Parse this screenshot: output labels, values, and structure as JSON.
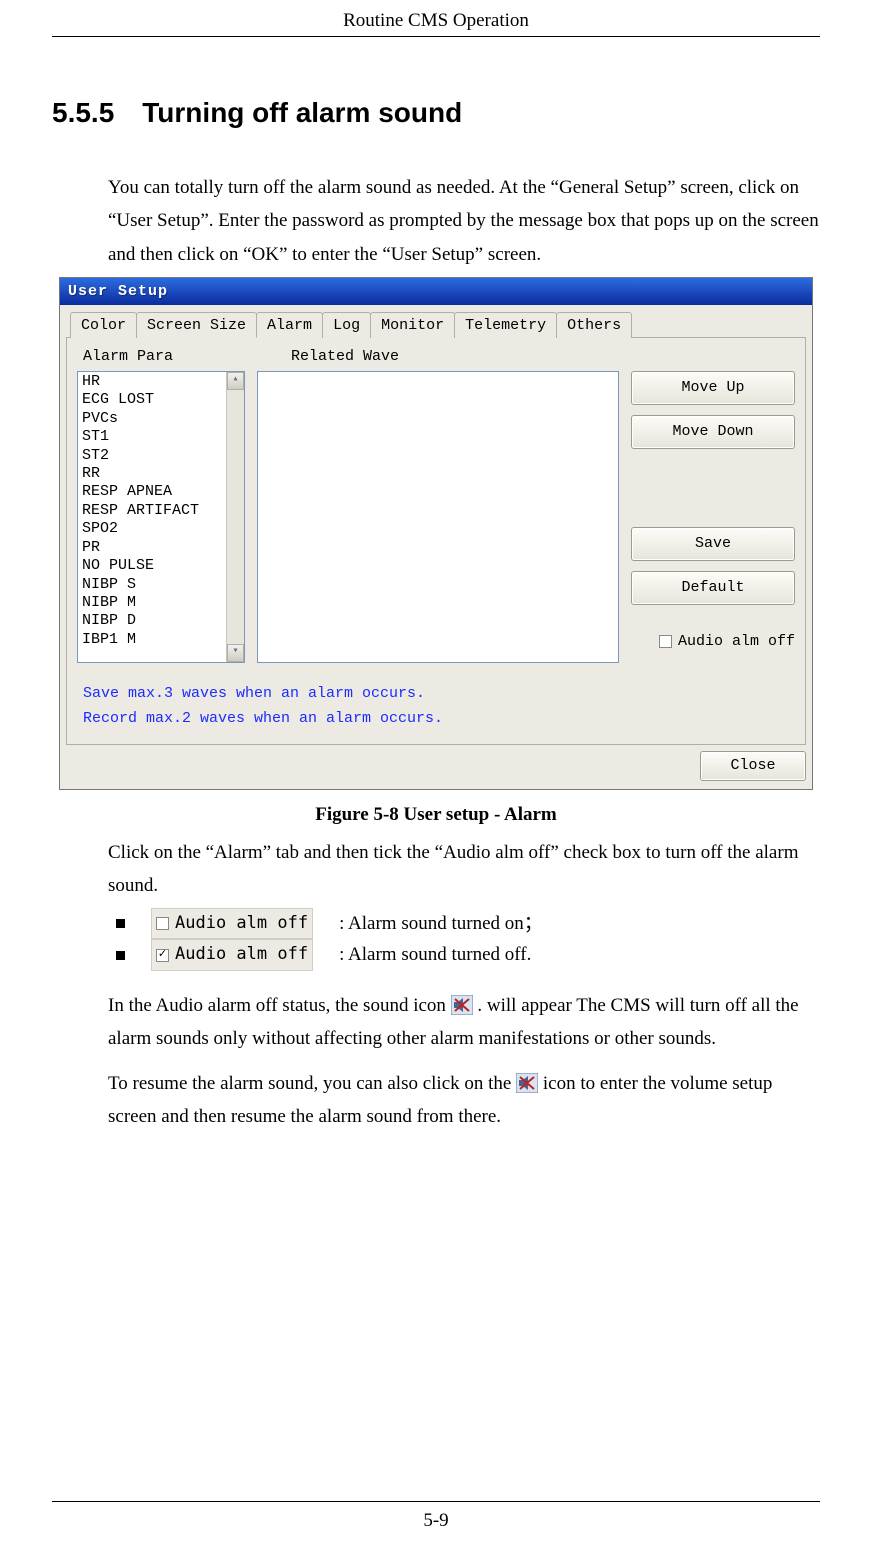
{
  "header": {
    "title": "Routine CMS Operation"
  },
  "section": {
    "number": "5.5.5",
    "title": "Turning off alarm sound"
  },
  "paragraphs": {
    "intro": "You can totally turn off the alarm sound as needed. At the “General Setup” screen, click on “User Setup”. Enter the password as prompted by the message box that pops up on the screen and then click on “OK” to enter the “User Setup” screen.",
    "after_figure": "Click on the “Alarm” tab and then tick the “Audio alm off” check box to turn off the alarm sound.",
    "bullet_on_label": "Audio alm off",
    "bullet_on_desc": ": Alarm sound turned on；",
    "bullet_off_label": "Audio alm off",
    "bullet_off_desc": ": Alarm sound turned off.",
    "status_p_a": "In the Audio alarm off status, the sound icon ",
    "status_p_b": ". will appear The CMS will turn off all the alarm sounds only without affecting other alarm manifestations or other sounds.",
    "resume_a": "To resume the alarm sound, you can also click on the ",
    "resume_b": " icon to enter the volume setup screen and then resume the alarm sound from there."
  },
  "figure": {
    "caption": "Figure 5-8 User setup - Alarm"
  },
  "dialog": {
    "title": "User Setup",
    "tabs": [
      "Color",
      "Screen Size",
      "Alarm",
      "Log",
      "Monitor",
      "Telemetry",
      "Others"
    ],
    "active_tab": "Alarm",
    "labels": {
      "alarm_para": "Alarm Para",
      "related_wave": "Related Wave"
    },
    "list_items": [
      "HR",
      "ECG LOST",
      "PVCs",
      "ST1",
      "ST2",
      "RR",
      "RESP APNEA",
      "RESP ARTIFACT",
      "SPO2",
      "PR",
      "NO PULSE",
      "NIBP S",
      "NIBP M",
      "NIBP D",
      "IBP1 M"
    ],
    "buttons": {
      "move_up": "Move Up",
      "move_down": "Move Down",
      "save": "Save",
      "default": "Default",
      "close": "Close"
    },
    "audio_off_label": "Audio alm off",
    "hint1": "Save max.3 waves when an alarm occurs.",
    "hint2": "Record max.2 waves when an alarm occurs."
  },
  "footer": {
    "page": "5-9"
  }
}
